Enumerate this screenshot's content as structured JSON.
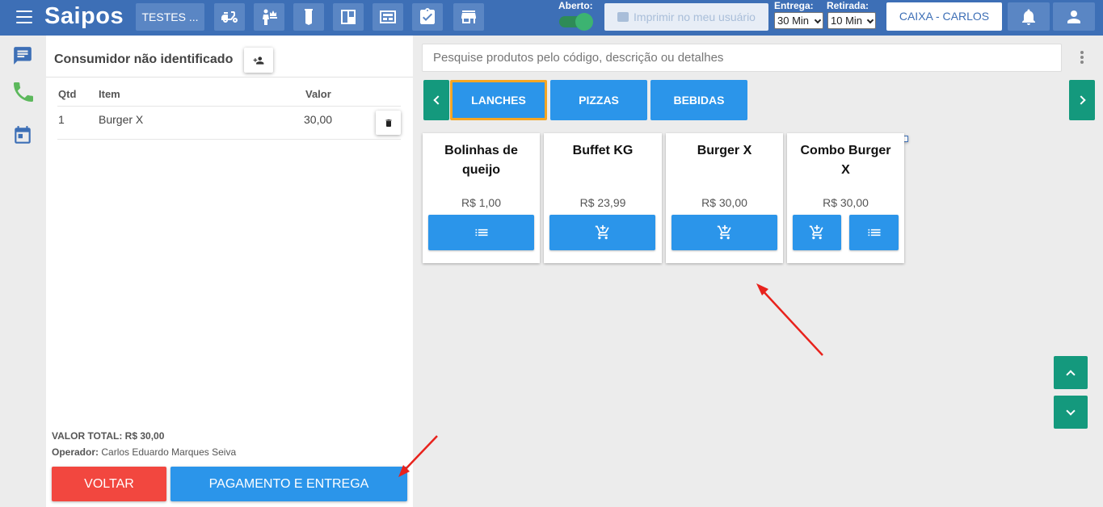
{
  "header": {
    "logo": "Saipos",
    "store_name": "TESTES ...",
    "nav_icons": [
      "delivery-icon",
      "table-service-icon",
      "tab-order-icon",
      "kanban-icon",
      "counter-icon",
      "checklist-icon",
      "store-icon"
    ],
    "open_label": "Aberto:",
    "print_label": "Imprimir no meu usuário",
    "delivery_label": "Entrega:",
    "delivery_value": "30 Min",
    "pickup_label": "Retirada:",
    "pickup_value": "10 Min",
    "cashier_label": "CAIXA - CARLOS",
    "brand_color": "#3d6fb6"
  },
  "rail": {
    "icons": [
      "chat-icon",
      "phone-icon",
      "calendar-icon"
    ]
  },
  "order": {
    "customer": "Consumidor não identificado",
    "columns": {
      "qty": "Qtd",
      "item": "Item",
      "value": "Valor"
    },
    "items": [
      {
        "qty": "1",
        "item": "Burger X",
        "value": "30,00"
      }
    ],
    "total_label": "VALOR TOTAL:",
    "total_value": "R$ 30,00",
    "operator_label": "Operador:",
    "operator_name": "Carlos Eduardo Marques Seiva",
    "back_label": "VOLTAR",
    "payment_label": "PAGAMENTO E ENTREGA"
  },
  "products": {
    "search_placeholder": "Pesquise produtos pelo código, descrição ou detalhes",
    "categories": [
      {
        "label": "LANCHES",
        "active": true
      },
      {
        "label": "PIZZAS",
        "active": false
      },
      {
        "label": "BEBIDAS",
        "active": false
      }
    ],
    "items": [
      {
        "name": "Bolinhas de queijo",
        "price": "R$ 1,00",
        "actions": [
          "list"
        ]
      },
      {
        "name": "Buffet KG",
        "price": "R$ 23,99",
        "actions": [
          "cart"
        ]
      },
      {
        "name": "Burger X",
        "price": "R$ 30,00",
        "actions": [
          "cart"
        ]
      },
      {
        "name": "Combo Burger X",
        "price": "R$ 30,00",
        "actions": [
          "cart",
          "list"
        ]
      }
    ],
    "accent_color": "#2b95ea",
    "nav_color": "#14997d",
    "active_outline": "#f5a623"
  }
}
